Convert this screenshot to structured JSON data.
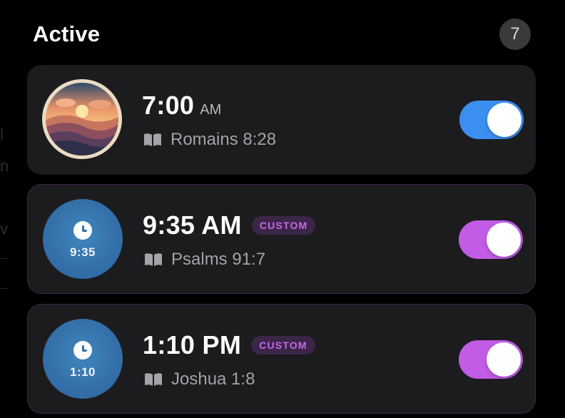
{
  "header": {
    "title": "Active",
    "count": "7"
  },
  "colors": {
    "toggle_default": "#3b8ff0",
    "toggle_custom": "#c25be6",
    "custom_tag_text": "#c667ee",
    "custom_tag_bg": "#3b2648"
  },
  "alarms": [
    {
      "time": "7:00",
      "ampm": "AM",
      "verse": "Romains 8:28",
      "avatar": "sunset-mountains-image",
      "enabled": true,
      "custom": false
    },
    {
      "time": "9:35 AM",
      "tag": "CUSTOM",
      "verse": "Psalms 91:7",
      "avatar_label": "9:35",
      "avatar": "clock-icon",
      "enabled": true,
      "custom": true
    },
    {
      "time": "1:10 PM",
      "tag": "CUSTOM",
      "verse": "Joshua 1:8",
      "avatar_label": "1:10",
      "avatar": "clock-icon",
      "enabled": true,
      "custom": true
    }
  ]
}
